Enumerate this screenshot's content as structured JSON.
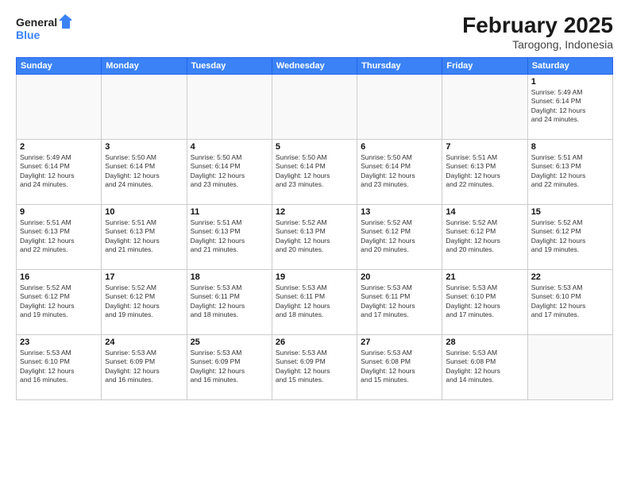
{
  "logo": {
    "line1": "General",
    "line2": "Blue"
  },
  "title": "February 2025",
  "subtitle": "Tarogong, Indonesia",
  "days_of_week": [
    "Sunday",
    "Monday",
    "Tuesday",
    "Wednesday",
    "Thursday",
    "Friday",
    "Saturday"
  ],
  "weeks": [
    [
      {
        "day": "",
        "info": ""
      },
      {
        "day": "",
        "info": ""
      },
      {
        "day": "",
        "info": ""
      },
      {
        "day": "",
        "info": ""
      },
      {
        "day": "",
        "info": ""
      },
      {
        "day": "",
        "info": ""
      },
      {
        "day": "1",
        "info": "Sunrise: 5:49 AM\nSunset: 6:14 PM\nDaylight: 12 hours\nand 24 minutes."
      }
    ],
    [
      {
        "day": "2",
        "info": "Sunrise: 5:49 AM\nSunset: 6:14 PM\nDaylight: 12 hours\nand 24 minutes."
      },
      {
        "day": "3",
        "info": "Sunrise: 5:50 AM\nSunset: 6:14 PM\nDaylight: 12 hours\nand 24 minutes."
      },
      {
        "day": "4",
        "info": "Sunrise: 5:50 AM\nSunset: 6:14 PM\nDaylight: 12 hours\nand 23 minutes."
      },
      {
        "day": "5",
        "info": "Sunrise: 5:50 AM\nSunset: 6:14 PM\nDaylight: 12 hours\nand 23 minutes."
      },
      {
        "day": "6",
        "info": "Sunrise: 5:50 AM\nSunset: 6:14 PM\nDaylight: 12 hours\nand 23 minutes."
      },
      {
        "day": "7",
        "info": "Sunrise: 5:51 AM\nSunset: 6:13 PM\nDaylight: 12 hours\nand 22 minutes."
      },
      {
        "day": "8",
        "info": "Sunrise: 5:51 AM\nSunset: 6:13 PM\nDaylight: 12 hours\nand 22 minutes."
      }
    ],
    [
      {
        "day": "9",
        "info": "Sunrise: 5:51 AM\nSunset: 6:13 PM\nDaylight: 12 hours\nand 22 minutes."
      },
      {
        "day": "10",
        "info": "Sunrise: 5:51 AM\nSunset: 6:13 PM\nDaylight: 12 hours\nand 21 minutes."
      },
      {
        "day": "11",
        "info": "Sunrise: 5:51 AM\nSunset: 6:13 PM\nDaylight: 12 hours\nand 21 minutes."
      },
      {
        "day": "12",
        "info": "Sunrise: 5:52 AM\nSunset: 6:13 PM\nDaylight: 12 hours\nand 20 minutes."
      },
      {
        "day": "13",
        "info": "Sunrise: 5:52 AM\nSunset: 6:12 PM\nDaylight: 12 hours\nand 20 minutes."
      },
      {
        "day": "14",
        "info": "Sunrise: 5:52 AM\nSunset: 6:12 PM\nDaylight: 12 hours\nand 20 minutes."
      },
      {
        "day": "15",
        "info": "Sunrise: 5:52 AM\nSunset: 6:12 PM\nDaylight: 12 hours\nand 19 minutes."
      }
    ],
    [
      {
        "day": "16",
        "info": "Sunrise: 5:52 AM\nSunset: 6:12 PM\nDaylight: 12 hours\nand 19 minutes."
      },
      {
        "day": "17",
        "info": "Sunrise: 5:52 AM\nSunset: 6:12 PM\nDaylight: 12 hours\nand 19 minutes."
      },
      {
        "day": "18",
        "info": "Sunrise: 5:53 AM\nSunset: 6:11 PM\nDaylight: 12 hours\nand 18 minutes."
      },
      {
        "day": "19",
        "info": "Sunrise: 5:53 AM\nSunset: 6:11 PM\nDaylight: 12 hours\nand 18 minutes."
      },
      {
        "day": "20",
        "info": "Sunrise: 5:53 AM\nSunset: 6:11 PM\nDaylight: 12 hours\nand 17 minutes."
      },
      {
        "day": "21",
        "info": "Sunrise: 5:53 AM\nSunset: 6:10 PM\nDaylight: 12 hours\nand 17 minutes."
      },
      {
        "day": "22",
        "info": "Sunrise: 5:53 AM\nSunset: 6:10 PM\nDaylight: 12 hours\nand 17 minutes."
      }
    ],
    [
      {
        "day": "23",
        "info": "Sunrise: 5:53 AM\nSunset: 6:10 PM\nDaylight: 12 hours\nand 16 minutes."
      },
      {
        "day": "24",
        "info": "Sunrise: 5:53 AM\nSunset: 6:09 PM\nDaylight: 12 hours\nand 16 minutes."
      },
      {
        "day": "25",
        "info": "Sunrise: 5:53 AM\nSunset: 6:09 PM\nDaylight: 12 hours\nand 16 minutes."
      },
      {
        "day": "26",
        "info": "Sunrise: 5:53 AM\nSunset: 6:09 PM\nDaylight: 12 hours\nand 15 minutes."
      },
      {
        "day": "27",
        "info": "Sunrise: 5:53 AM\nSunset: 6:08 PM\nDaylight: 12 hours\nand 15 minutes."
      },
      {
        "day": "28",
        "info": "Sunrise: 5:53 AM\nSunset: 6:08 PM\nDaylight: 12 hours\nand 14 minutes."
      },
      {
        "day": "",
        "info": ""
      }
    ]
  ]
}
